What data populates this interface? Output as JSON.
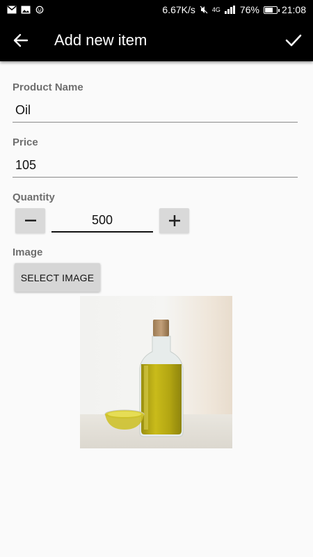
{
  "status_bar": {
    "speed": "6.67K/s",
    "network": "4G",
    "battery": "76%",
    "battery_level": 0.76,
    "time": "21:08"
  },
  "app_bar": {
    "title": "Add new item"
  },
  "form": {
    "product_name_label": "Product Name",
    "product_name_value": "Oil",
    "price_label": "Price",
    "price_value": "105",
    "quantity_label": "Quantity",
    "quantity_value": "500",
    "image_label": "Image",
    "select_image_label": "SELECT IMAGE"
  },
  "icons": {
    "back": "arrow-back-icon",
    "confirm": "check-icon",
    "decrement": "minus-icon",
    "increment": "plus-icon"
  },
  "colors": {
    "app_bar": "#000000",
    "background": "#fafafa",
    "button": "#d9d9d9",
    "label": "#6e6e6e"
  }
}
